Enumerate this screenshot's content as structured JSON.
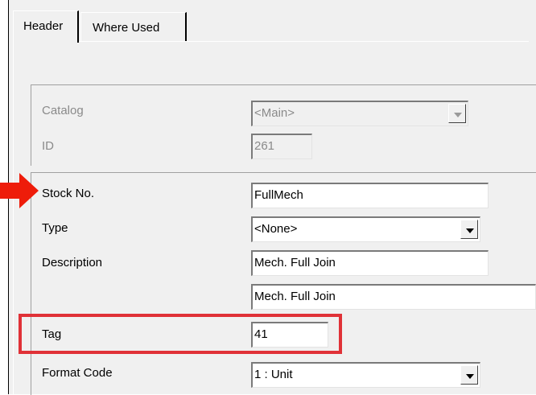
{
  "tabs": [
    {
      "label": "Header"
    },
    {
      "label": "Where Used"
    }
  ],
  "fields": {
    "catalog": {
      "label": "Catalog",
      "value": "<Main>"
    },
    "id": {
      "label": "ID",
      "value": "261"
    },
    "stock_no": {
      "label": "Stock No.",
      "value": "FullMech"
    },
    "type": {
      "label": "Type",
      "value": "<None>"
    },
    "description": {
      "label": "Description",
      "value": "Mech. Full Join"
    },
    "description2": {
      "value": "Mech. Full Join"
    },
    "tag": {
      "label": "Tag",
      "value": "41"
    },
    "format_code": {
      "label": "Format Code",
      "value": "1 : Unit"
    }
  },
  "colors": {
    "highlight": "#e03137",
    "arrow": "#ee1c0a"
  },
  "icons": {
    "pointer": "red-arrow-icon",
    "dropdown": "chevron-down-icon"
  }
}
